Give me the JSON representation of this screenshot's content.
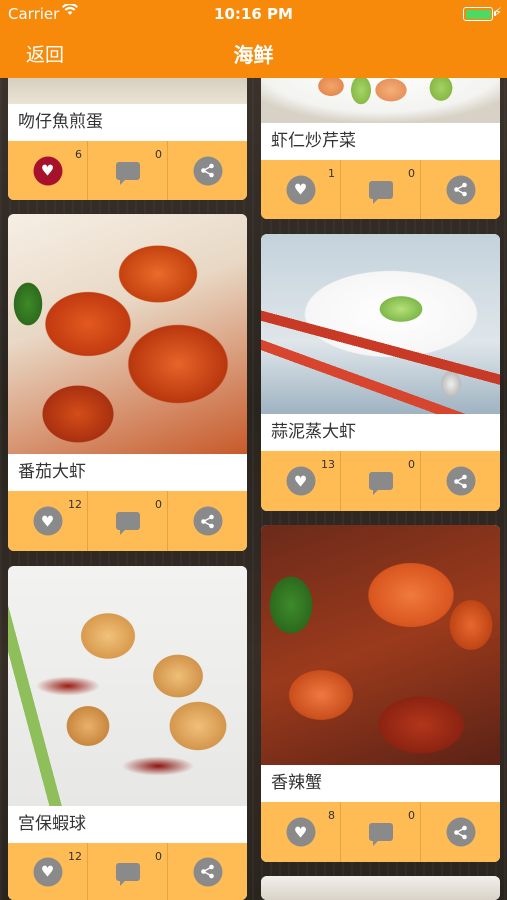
{
  "status": {
    "carrier": "Carrier",
    "time": "10:16 PM",
    "battery_level": 1.0
  },
  "navbar": {
    "back_label": "返回",
    "title": "海鲜"
  },
  "colors": {
    "accent": "#f7890b",
    "action_bar": "#ffbc55",
    "liked": "#a6122b",
    "icon_gray": "#8a8a8a"
  },
  "left_column": [
    {
      "name": "吻仔魚煎蛋",
      "likes": "6",
      "comments": "0",
      "liked": true
    },
    {
      "name": "番茄大虾",
      "likes": "12",
      "comments": "0",
      "liked": false
    },
    {
      "name": "宫保蝦球",
      "likes": "12",
      "comments": "0",
      "liked": false
    }
  ],
  "right_column": [
    {
      "name": "虾仁炒芹菜",
      "likes": "1",
      "comments": "0",
      "liked": false
    },
    {
      "name": "蒜泥蒸大虾",
      "likes": "13",
      "comments": "0",
      "liked": false
    },
    {
      "name": "香辣蟹",
      "likes": "8",
      "comments": "0",
      "liked": false
    }
  ],
  "icons": {
    "like": "heart-icon",
    "comment": "comment-icon",
    "share": "share-icon"
  }
}
